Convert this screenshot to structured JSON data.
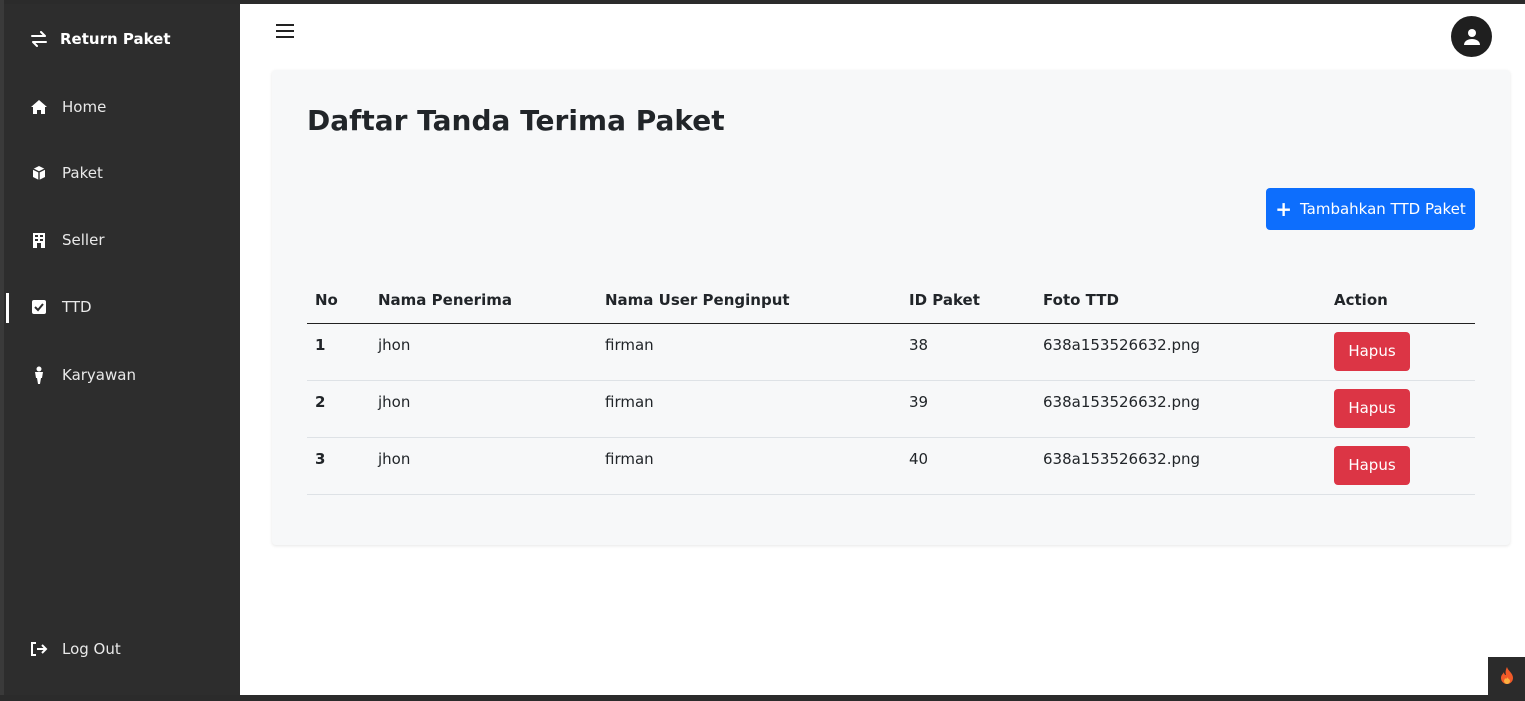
{
  "sidebar": {
    "brand": {
      "label": "Return Paket",
      "icon": "swap-arrows-icon"
    },
    "items": [
      {
        "label": "Home",
        "icon": "home-icon",
        "active": false
      },
      {
        "label": "Paket",
        "icon": "box-icon",
        "active": false
      },
      {
        "label": "Seller",
        "icon": "building-icon",
        "active": false
      },
      {
        "label": "TTD",
        "icon": "check-square-icon",
        "active": true
      },
      {
        "label": "Karyawan",
        "icon": "person-icon",
        "active": false
      }
    ],
    "logout": {
      "label": "Log Out",
      "icon": "logout-icon"
    }
  },
  "header": {
    "menu_icon": "hamburger-icon",
    "avatar_icon": "user-avatar-icon"
  },
  "main": {
    "title": "Daftar Tanda Terima Paket",
    "add_button_label": "Tambahkan TTD Paket",
    "table": {
      "headers": [
        "No",
        "Nama Penerima",
        "Nama User Penginput",
        "ID Paket",
        "Foto TTD",
        "Action"
      ],
      "rows": [
        {
          "no": "1",
          "penerima": "jhon",
          "penginput": "firman",
          "id_paket": "38",
          "foto": "638a153526632.png",
          "action": "Hapus"
        },
        {
          "no": "2",
          "penerima": "jhon",
          "penginput": "firman",
          "id_paket": "39",
          "foto": "638a153526632.png",
          "action": "Hapus"
        },
        {
          "no": "3",
          "penerima": "jhon",
          "penginput": "firman",
          "id_paket": "40",
          "foto": "638a153526632.png",
          "action": "Hapus"
        }
      ]
    }
  },
  "colors": {
    "sidebar_bg": "#2d2d2d",
    "primary": "#0d6efd",
    "danger": "#dc3545",
    "card_bg": "#f7f8f9"
  }
}
